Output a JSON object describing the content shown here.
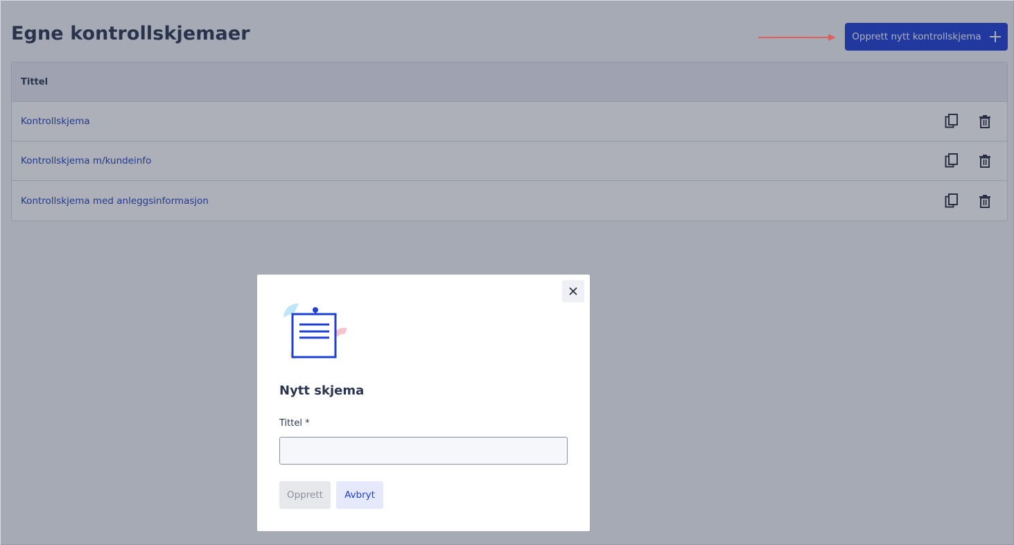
{
  "page": {
    "title": "Egne kontrollskjemaer",
    "create_button_label": "Opprett nytt kontrollskjema"
  },
  "table": {
    "column_header": "Tittel",
    "rows": [
      {
        "title": "Kontrollskjema"
      },
      {
        "title": "Kontrollskjema m/kundeinfo"
      },
      {
        "title": "Kontrollskjema med anleggsinformasjon"
      }
    ],
    "row_action_icons": [
      "copy-icon",
      "trash-icon"
    ]
  },
  "modal": {
    "title": "Nytt skjema",
    "field_label": "Tittel *",
    "field_value": "",
    "create_label": "Opprett",
    "cancel_label": "Avbryt",
    "close_icon": "close-icon"
  },
  "colors": {
    "primary": "#1e3fd6",
    "link": "#1e3fb8",
    "annotation_arrow": "#e0605c"
  }
}
